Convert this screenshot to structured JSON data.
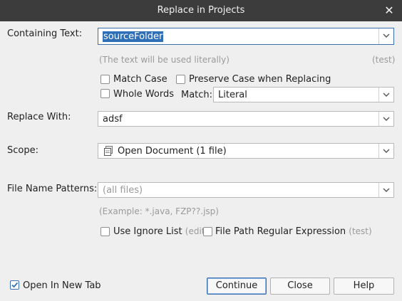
{
  "window": {
    "title": "Replace in Projects"
  },
  "containing_text": {
    "label": "Containing Text:",
    "value": "sourceFolder",
    "hint": "(The text will be used literally)",
    "test_link": "(test)"
  },
  "options": {
    "match_case": {
      "label": "Match Case",
      "checked": false
    },
    "preserve_case": {
      "label": "Preserve Case when Replacing",
      "checked": false
    },
    "whole_words": {
      "label": "Whole Words",
      "checked": false
    },
    "match_label": "Match:",
    "match_value": "Literal"
  },
  "replace_with": {
    "label": "Replace With:",
    "value": "adsf"
  },
  "scope": {
    "label": "Scope:",
    "value": "Open Document (1 file)"
  },
  "file_name_patterns": {
    "label": "File Name Patterns:",
    "placeholder": "(all files)",
    "example": "(Example: *.java, FZP??.jsp)"
  },
  "ignore": {
    "use_ignore_list": {
      "label": "Use Ignore List",
      "checked": false,
      "edit_link": "(edit)"
    },
    "file_path_regex": {
      "label": "File Path Regular Expression",
      "checked": false,
      "test_link": "(test)"
    }
  },
  "footer": {
    "open_in_new_tab": {
      "label": "Open In New Tab",
      "checked": true
    },
    "continue_label": "Continue",
    "close_label": "Close",
    "help_label": "Help"
  },
  "colors": {
    "titlebar": "#3c3c3c",
    "selection": "#2f6fb7",
    "accent": "#3a6fb0"
  }
}
